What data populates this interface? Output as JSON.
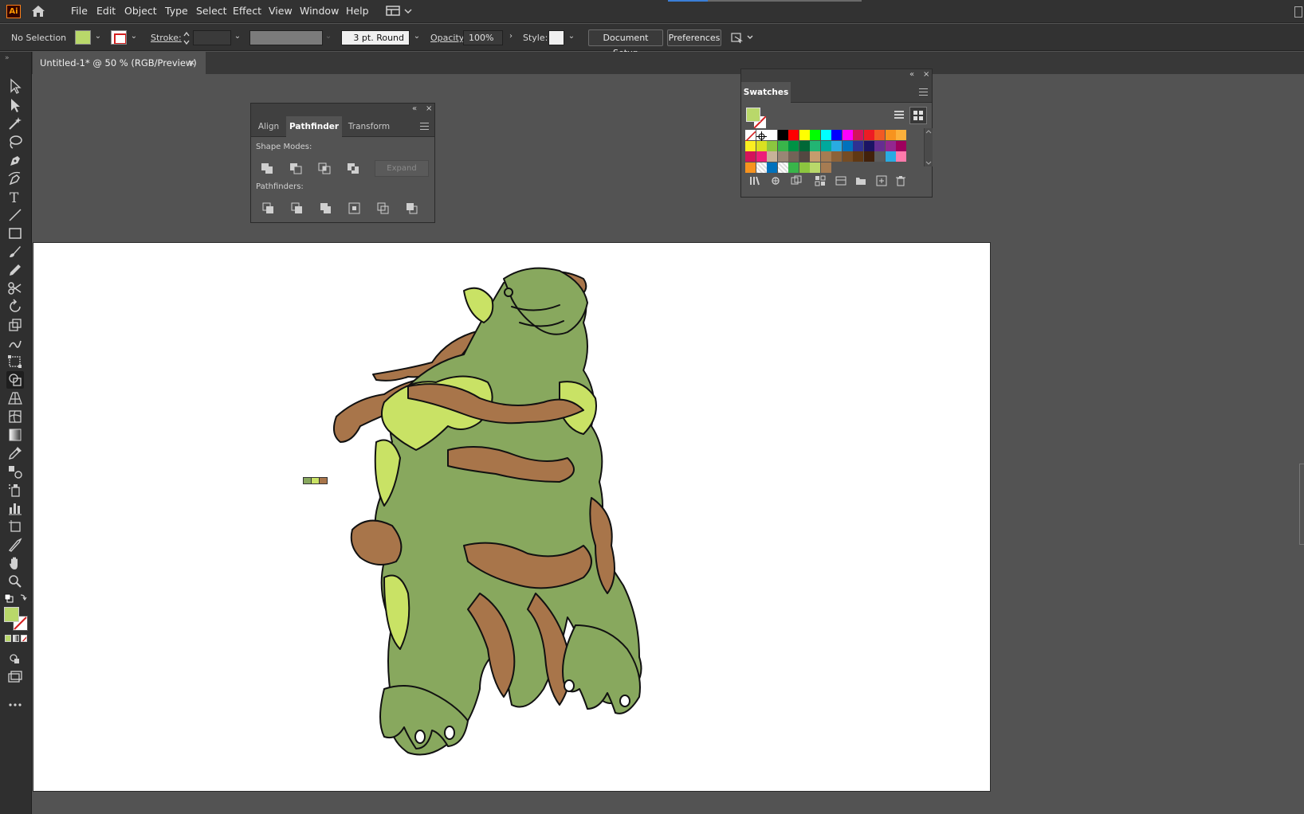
{
  "app": {
    "logo": "Ai",
    "menus": [
      "File",
      "Edit",
      "Object",
      "Type",
      "Select",
      "Effect",
      "View",
      "Window",
      "Help"
    ]
  },
  "control_bar": {
    "selection_label": "No Selection",
    "stroke_label": "Stroke:",
    "stroke_weight_value": "",
    "brush_value": "3 pt. Round",
    "opacity_label": "Opacity:",
    "opacity_value": "100%",
    "style_label": "Style:",
    "document_setup_button": "Document Setup",
    "preferences_button": "Preferences",
    "fill_color": "#b9d86a"
  },
  "document": {
    "tab_title": "Untitled-1* @ 50 % (RGB/Preview)",
    "close_symbol": "×"
  },
  "pathfinder_panel": {
    "tabs": [
      "Align",
      "Pathfinder",
      "Transform"
    ],
    "active_tab": "Pathfinder",
    "shape_modes_label": "Shape Modes:",
    "expand_button": "Expand",
    "pathfinders_label": "Pathfinders:"
  },
  "swatches_panel": {
    "title": "Swatches",
    "colors": {
      "row1": [
        "none",
        "registration",
        "#ffffff",
        "#000000",
        "#ff0000",
        "#ffff00",
        "#00ff00",
        "#00ffff",
        "#0000ff",
        "#ff00ff",
        "#d4145a",
        "#ed1c24",
        "#f15a24",
        "#f7931e",
        "#fbb03b"
      ],
      "row2": [
        "#fcee21",
        "#d9e021",
        "#8cc63f",
        "#39b54a",
        "#009245",
        "#006837",
        "#22b573",
        "#00a99d",
        "#29abe2",
        "#0071bc",
        "#2e3192",
        "#1b1464",
        "#662d91",
        "#93278f",
        "#9e005d"
      ],
      "row3": [
        "#d4145a",
        "#ed1e79",
        "#c7b299",
        "#998675",
        "#736357",
        "#534741",
        "#c69c6d",
        "#a67c52",
        "#8c6239",
        "#754c24",
        "#603813",
        "#42210b",
        "#5c5c5c",
        "#29abe2",
        "#ff7bac"
      ],
      "row4": [
        "#f7931e",
        "pattern",
        "#0071bc",
        "pattern",
        "#39b54a",
        "#8cc63f",
        "#b9d86a",
        "#a67c52"
      ]
    }
  },
  "artwork": {
    "green": "#88a85e",
    "light_green": "#c9e265",
    "brown": "#a8754a",
    "outline": "#111111"
  }
}
